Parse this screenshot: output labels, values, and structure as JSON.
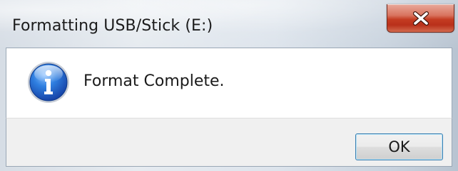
{
  "window": {
    "title": "Formatting USB/Stick (E:)",
    "close_icon": "close-icon"
  },
  "dialog": {
    "icon": "info-icon",
    "message": "Format Complete."
  },
  "buttons": {
    "ok_label": "OK"
  },
  "colors": {
    "close_button": "#c43c22",
    "info_icon": "#1f5fbf",
    "footer_bg": "#f0f0f0"
  }
}
